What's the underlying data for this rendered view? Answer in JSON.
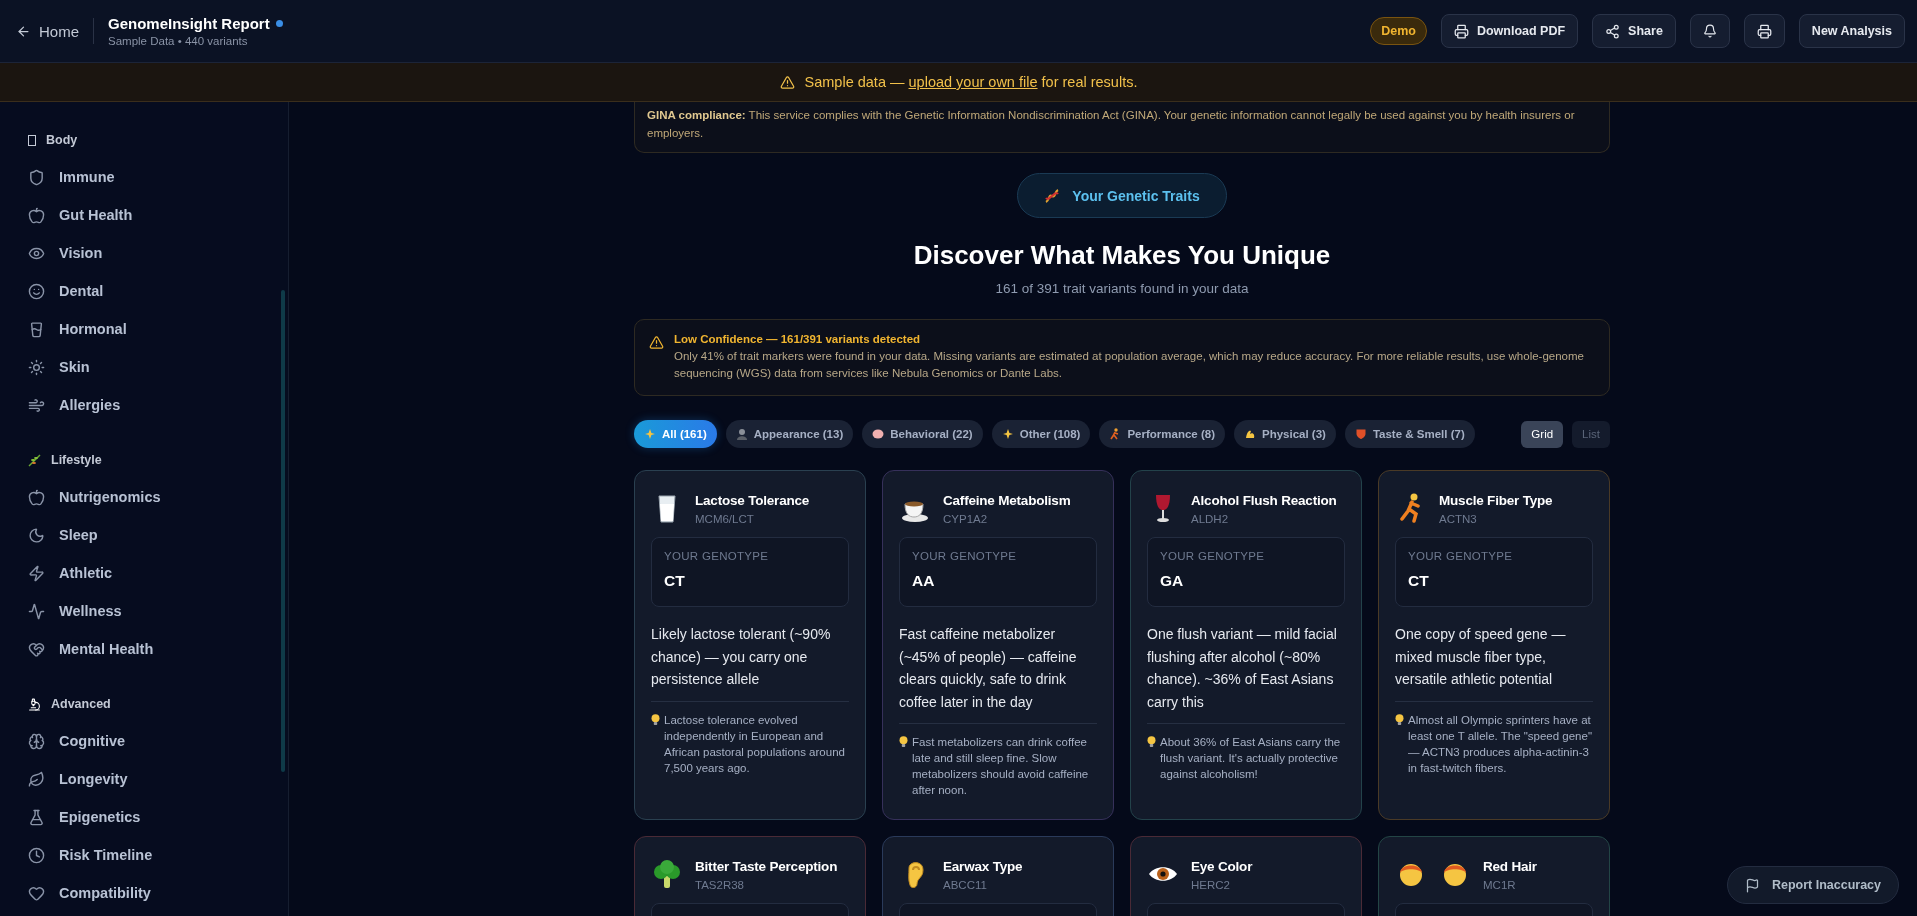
{
  "header": {
    "back_label": "Home",
    "title": "GenomeInsight Report",
    "subtitle": "Sample Data • 440 variants",
    "badge": "Demo",
    "buttons": [
      "Download PDF",
      "Share"
    ],
    "primary_button": "New Analysis"
  },
  "banner": {
    "prefix": "Sample data — ",
    "link": "upload your own file",
    "suffix": " for real results."
  },
  "sidebar": {
    "sections": [
      {
        "title": "Body",
        "items": [
          "Immune",
          "Gut Health",
          "Vision",
          "Dental",
          "Hormonal",
          "Skin",
          "Allergies"
        ]
      },
      {
        "title": "Lifestyle",
        "items": [
          "Nutrigenomics",
          "Sleep",
          "Athletic",
          "Wellness",
          "Mental Health"
        ]
      },
      {
        "title": "Advanced",
        "items": [
          "Cognitive",
          "Longevity",
          "Epigenetics",
          "Risk Timeline",
          "Compatibility"
        ]
      }
    ]
  },
  "notice": {
    "text": "**GINA compliance:** This service complies with the Genetic Information Nondiscrimination Act (GINA). Your genetic information cannot legally be used against you by health insurers or employers."
  },
  "section_pill": "Your Genetic Traits",
  "heading": "Discover What Makes You Unique",
  "subheading": "161 of 391 trait variants found in your data",
  "warning": {
    "title": "Low Confidence — 161/391 variants detected",
    "body": "Only 41% of trait markers were found in your data. Missing variants are estimated at population average, which may reduce accuracy. For more reliable results, use whole-genome sequencing (WGS) data from services like Nebula Genomics or Dante Labs."
  },
  "filters": [
    {
      "label": "All (161)",
      "selected": true
    },
    {
      "label": "Appearance (13)",
      "selected": false
    },
    {
      "label": "Behavioral (22)",
      "selected": false
    },
    {
      "label": "Other (108)",
      "selected": false
    },
    {
      "label": "Performance (8)",
      "selected": false
    },
    {
      "label": "Physical (3)",
      "selected": false
    },
    {
      "label": "Taste & Smell (7)",
      "selected": false
    }
  ],
  "view_toggle": [
    {
      "label": "Grid",
      "selected": true
    },
    {
      "label": "List",
      "selected": false
    }
  ],
  "cards": [
    {
      "title": "Lactose Tolerance",
      "gene": "MCM6/LCT",
      "color": "#2a4050",
      "genotype_label": "YOUR GENOTYPE",
      "genotype": "CT",
      "description": "Likely lactose tolerant (~90% chance) — you carry one persistence allele",
      "fact": "Lactose tolerance evolved independently in European and African pastoral populations around 7,500 years ago."
    },
    {
      "title": "Caffeine Metabolism",
      "gene": "CYP1A2",
      "color": "#36305a",
      "genotype_label": "YOUR GENOTYPE",
      "genotype": "AA",
      "description": "Fast caffeine metabolizer (~45% of people) — caffeine clears quickly, safe to drink coffee later in the day",
      "fact": "Fast metabolizers can drink coffee late and still sleep fine. Slow metabolizers should avoid caffeine after noon."
    },
    {
      "title": "Alcohol Flush Reaction",
      "gene": "ALDH2",
      "color": "#23424a",
      "genotype_label": "YOUR GENOTYPE",
      "genotype": "GA",
      "description": "One flush variant — mild facial flushing after alcohol (~80% chance). ~36% of East Asians carry this",
      "fact": "About 36% of East Asians carry the flush variant. It's actually protective against alcoholism!"
    },
    {
      "title": "Muscle Fiber Type",
      "gene": "ACTN3",
      "color": "#4a3a26",
      "genotype_label": "YOUR GENOTYPE",
      "genotype": "CT",
      "description": "One copy of speed gene — mixed muscle fiber type, versatile athletic potential",
      "fact": "Almost all Olympic sprinters have at least one T allele. The \"speed gene\" — ACTN3 produces alpha-actinin-3 in fast-twitch fibers."
    },
    {
      "title": "Bitter Taste Perception",
      "gene": "TAS2R38",
      "color": "#4a2a36"
    },
    {
      "title": "Earwax Type",
      "gene": "ABCC11",
      "color": "#2a3a5a"
    },
    {
      "title": "Eye Color",
      "gene": "HERC2",
      "color": "#4a2a36"
    },
    {
      "title": "Red Hair",
      "gene": "MC1R",
      "color": "#234545"
    }
  ],
  "report_button": "Report Inaccuracy"
}
